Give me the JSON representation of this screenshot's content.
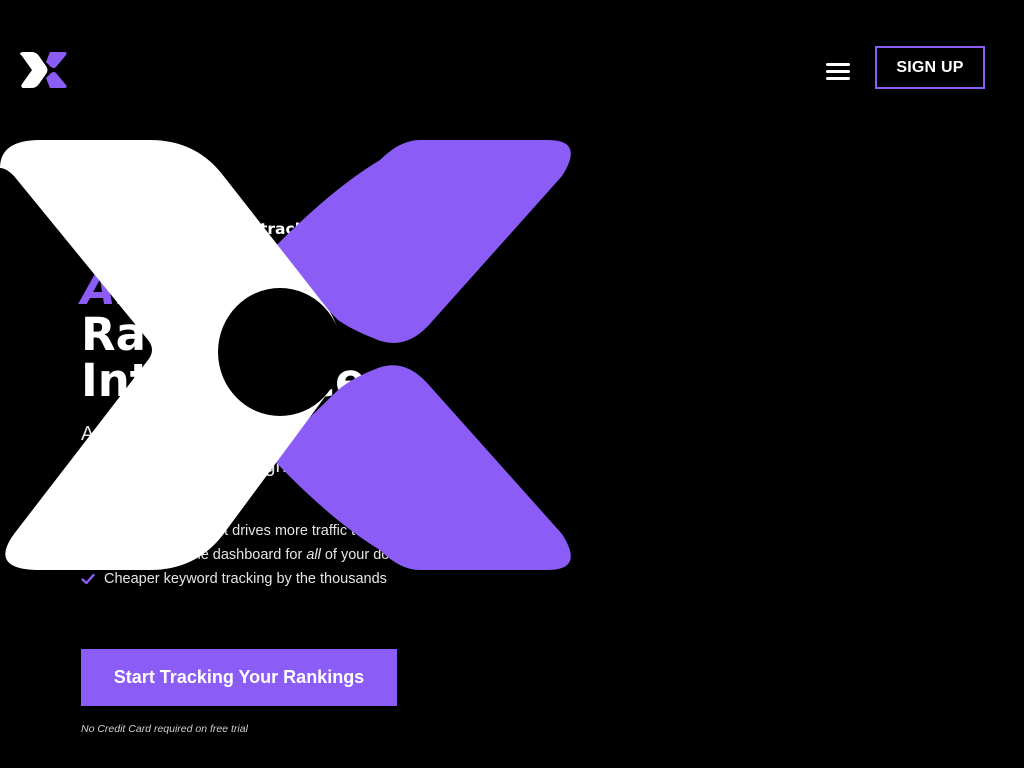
{
  "colors": {
    "background": "#000000",
    "accent": "#8b5cf6",
    "text": "#ffffff"
  },
  "header": {
    "logo_icon": "x-logo-icon",
    "menu_icon": "hamburger-menu-icon",
    "signup_label": "SIGN UP"
  },
  "hero": {
    "eyebrow": "tracking software for",
    "headline_accent": "AI-Enable",
    "headline_line2": "Ra",
    "headline_line3": "Int   igence",
    "subhead_line1": "A                                 at uses AI to deliver",
    "subhead_line2": "                                 ghts at scale",
    "features": [
      {
        "icon": "check-icon",
        "text": "                   content drives more traffic to your website"
      },
      {
        "icon": "check-icon",
        "text_before": "                th one dashboard for ",
        "text_emphasis": "all",
        "text_after": " of your domains"
      },
      {
        "icon": "check-icon",
        "text": "Cheaper keyword tracking by the thousands"
      }
    ],
    "cta_label": "Start Tracking Your Rankings",
    "note": "No Credit Card required on free trial"
  }
}
